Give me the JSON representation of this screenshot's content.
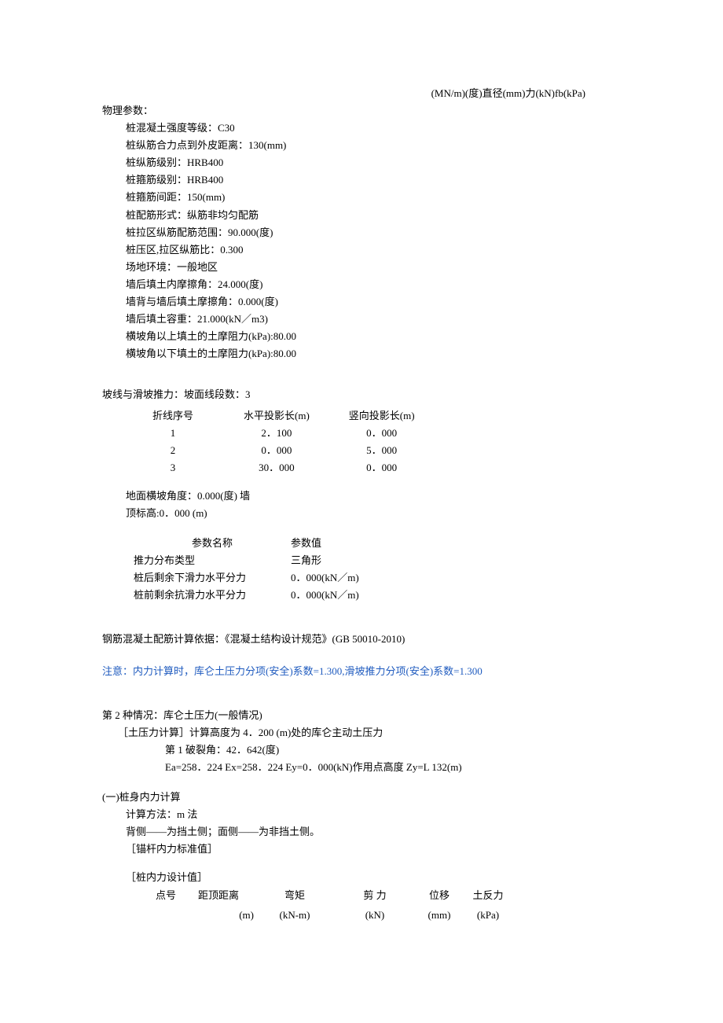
{
  "top_right": "(MN/m)(度)直径(mm)力(kN)fb(kPa)",
  "physics": {
    "heading": "物理参数：",
    "items": [
      "桩混凝土强度等级：C30",
      "桩纵筋合力点到外皮距离：130(mm)",
      "桩纵筋级别：HRB400",
      "桩箍筋级别：HRB400",
      "桩箍筋间距：150(mm)",
      "桩配筋形式：纵筋非均匀配筋",
      "桩拉区纵筋配筋范围：90.000(度)",
      "桩压区,拉区纵筋比：0.300",
      "场地环境：一般地区",
      "墙后填土内摩擦角：24.000(度)",
      "墙背与墙后填土摩擦角：0.000(度)",
      "墙后填土容重：21.000(kN／m3)",
      "横坡角以上填土的土摩阻力(kPa):80.00",
      "横坡角以下填土的土摩阻力(kPa):80.00"
    ]
  },
  "slope": {
    "heading": "坡线与滑坡推力：坡面线段数：3",
    "table": {
      "headers": [
        "折线序号",
        "水平投影长(m)",
        "竖向投影长(m)"
      ],
      "rows": [
        [
          "1",
          "2．100",
          "0．000"
        ],
        [
          "2",
          "0．000",
          "5．000"
        ],
        [
          "3",
          "30．000",
          "0．000"
        ]
      ]
    },
    "notes": [
      "地面横坡角度：0.000(度)  墙",
      "顶标高:0．000 (m)"
    ],
    "params": {
      "headers": [
        "参数名称",
        "参数值"
      ],
      "rows": [
        [
          "推力分布类型",
          "三角形"
        ],
        [
          "桩后剩余下滑力水平分力",
          "0．000(kN／m)"
        ],
        [
          "桩前剩余抗滑力水平分力",
          "0．000(kN／m)"
        ]
      ]
    }
  },
  "rebar_basis": "钢筋混凝土配筋计算依据：《混凝土结构设计规范》(GB 50010-2010)",
  "notice": "注意：内力计算时，库仑土压力分项(安全)系数=1.300,滑坡推力分项(安全)系数=1.300",
  "case2": {
    "heading": "第 2 种情况：库仑土压力(一般情况)",
    "line1": "［土压力计算］计算高度为 4．200 (m)处的库仑主动土压力",
    "line2": "第 1 破裂角：42．642(度)",
    "line3": "Ea=258．224 Ex=258．224 Ey=0．000(kN)作用点高度 Zy=L 132(m)"
  },
  "calc": {
    "heading": "(一)桩身内力计算",
    "method": "计算方法：m 法",
    "sides": "背侧——为挡土侧；面侧——为非挡土侧。",
    "anchor": "［锚杆内力标准值］",
    "design_title": "［桩内力设计值］",
    "design_headers_row1": [
      "点号",
      "距顶距离",
      "弯矩",
      "剪  力",
      "位移",
      "土反力"
    ],
    "design_headers_row2": [
      "",
      "(m)",
      "(kN-m)",
      "(kN)",
      "(mm)",
      "(kPa)"
    ]
  }
}
